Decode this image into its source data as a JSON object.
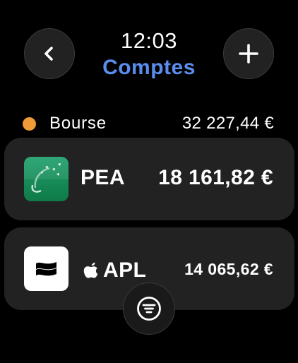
{
  "header": {
    "time": "12:03",
    "title": "Comptes",
    "back_icon": "chevron-left-icon",
    "add_icon": "plus-icon"
  },
  "section": {
    "label": "Bourse",
    "total": "32 227,44 €",
    "dot_color": "#f09a38"
  },
  "accounts": [
    {
      "name": "PEA",
      "value": "18 161,82 €",
      "logo": "bnp-paribas-logo"
    },
    {
      "name": "APL",
      "value": "14 065,62 €",
      "logo": "trade-republic-logo",
      "prefix_icon": "apple-icon"
    }
  ],
  "footer": {
    "filter_icon": "filter-icon"
  },
  "colors": {
    "accent": "#5b8def",
    "background": "#000000",
    "card": "#222222"
  }
}
